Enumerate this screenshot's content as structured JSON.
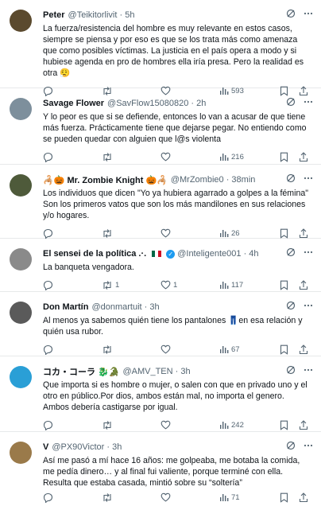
{
  "tweets": [
    {
      "name": "Peter",
      "handle": "@Teikitorlivit",
      "time": "5h",
      "text": "La fuerza/resistencia del hombre es muy relevante en estos casos, siempre se piensa y por eso es que se los trata más como amenaza que como posibles víctimas. La justicia en el país opera a modo y si hubiese agenda en pro de hombres ella iría presa. Pero la realidad es otra 😮‍💨",
      "replies": "",
      "retweets": "",
      "likes": "",
      "views": "593",
      "avatar_color": "#5b4a2e"
    },
    {
      "name": "Savage Flower",
      "handle": "@SavFlow15080820",
      "time": "2h",
      "text": "Y lo peor es que si se defiende, entonces lo van a acusar de que tiene más fuerza. Prácticamente tiene que dejarse pegar. No entiendo como se pueden quedar con alguien que l@s violenta",
      "replies": "",
      "retweets": "",
      "likes": "",
      "views": "216",
      "avatar_color": "#7d8f9c"
    },
    {
      "name": "🦂🎃 Mr. Zombie Knight 🎃🦂",
      "handle": "@MrZombie0",
      "time": "38min",
      "text": "Los individuos que dicen \"Yo ya hubiera agarrado a golpes a la fémina\" Son los primeros vatos que son los más mandilones en sus relaciones y/o hogares.",
      "replies": "",
      "retweets": "",
      "likes": "",
      "views": "26",
      "avatar_color": "#4e5a3a"
    },
    {
      "name": "El sensei de la política .·.",
      "handle": "@Inteligente001",
      "time": "4h",
      "text": "La banqueta vengadora.",
      "replies": "",
      "retweets": "1",
      "likes": "1",
      "views": "117",
      "avatar_color": "#8a8a8a"
    },
    {
      "name": "Don Martín",
      "handle": "@donmartuit",
      "time": "3h",
      "text": "Al menos ya sabemos quién tiene los pantalones 👖en esa relación y quién usa rubor.",
      "replies": "",
      "retweets": "",
      "likes": "",
      "views": "67",
      "avatar_color": "#5a5a5a"
    },
    {
      "name": "コカ・コーラ 🐉🐊",
      "handle": "@AMV_TEN",
      "time": "3h",
      "text": "Que importa si es hombre o mujer, o salen con que en privado uno y el otro en público.Por dios, ambos están mal, no importa el genero.\nAmbos debería castigarse por igual.",
      "replies": "",
      "retweets": "",
      "likes": "",
      "views": "242",
      "avatar_color": "#2a9fd6"
    },
    {
      "name": "V",
      "handle": "@PX90Victor",
      "time": "3h",
      "text": "Así me pasó a mí hace 16 años: me golpeaba, me botaba la comida, me pedía dinero… y al final fui valiente, porque terminé con ella. Resulta que estaba casada, mintió sobre su “soltería”",
      "replies": "",
      "retweets": "",
      "likes": "",
      "views": "71",
      "avatar_color": "#9a7a4a"
    }
  ]
}
